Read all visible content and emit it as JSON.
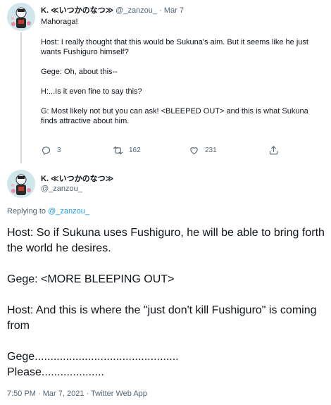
{
  "tweet1": {
    "display_name": "K. ≪いつかのなつ≫",
    "handle": "@_zanzou_",
    "date": "· Mar 7",
    "lines": [
      "Mahoraga!",
      "Host: I really thought that this would be Sukuna's aim. But it seems like he just wants Fushiguro himself?",
      "Gege: Oh, about this--",
      "H:...Is it even fine to say this?",
      "G: Most likely not but you can ask! <BLEEPED OUT> and this is what Sukuna finds attractive about him."
    ],
    "actions": {
      "reply_count": "3",
      "retweet_count": "162",
      "like_count": "231"
    }
  },
  "tweet2": {
    "display_name": "K. ≪いつかのなつ≫",
    "handle": "@_zanzou_",
    "replying_label": "Replying to",
    "replying_handle": "@_zanzou_",
    "lines": [
      "Host: So if Sukuna uses Fushiguro, he will be able to bring forth the world he desires.",
      "Gege: <MORE BLEEPING OUT>",
      "Host: And this is where the \"just don't kill Fushiguro\" is coming from",
      "Gege..............................................",
      "Please...................."
    ],
    "timestamp": "7:50 PM · Mar 7, 2021 · Twitter Web App"
  },
  "icons": {
    "reply": "reply-icon",
    "retweet": "retweet-icon",
    "like": "heart-icon",
    "share": "share-icon"
  },
  "colors": {
    "text": "#0f1419",
    "secondary": "#536471",
    "link": "#1d9bf0",
    "thread_line": "#cfd9de"
  }
}
